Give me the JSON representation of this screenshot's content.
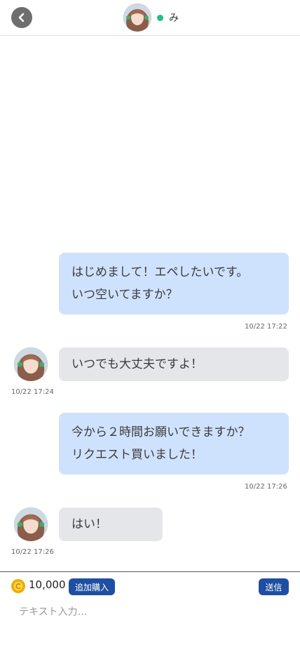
{
  "header": {
    "username": "み",
    "online_color": "#1fbf8f"
  },
  "messages": [
    {
      "direction": "outgoing",
      "lines": [
        "はじめまして！エペしたいです。",
        "いつ空いてますか？"
      ],
      "time": "10/22 17:22"
    },
    {
      "direction": "incoming",
      "lines": [
        "いつでも大丈夫ですよ！"
      ],
      "time": "10/22 17:24"
    },
    {
      "direction": "outgoing",
      "lines": [
        "今から２時間お願いできますか？",
        "リクエスト買いました！"
      ],
      "time": "10/22 17:26"
    },
    {
      "direction": "incoming",
      "lines": [
        "はい！"
      ],
      "time": "10/22 17:26"
    }
  ],
  "footer": {
    "coins": "10,000",
    "add_purchase_label": "追加購入",
    "send_label": "送信",
    "input_placeholder": "テキスト入力…",
    "input_value": ""
  },
  "colors": {
    "outgoing_bubble": "#cfe2fd",
    "incoming_bubble": "#e4e6ea",
    "button_blue": "#1f4fa0"
  },
  "icons": {
    "back": "chevron-left-icon",
    "coin": "coin-icon"
  }
}
